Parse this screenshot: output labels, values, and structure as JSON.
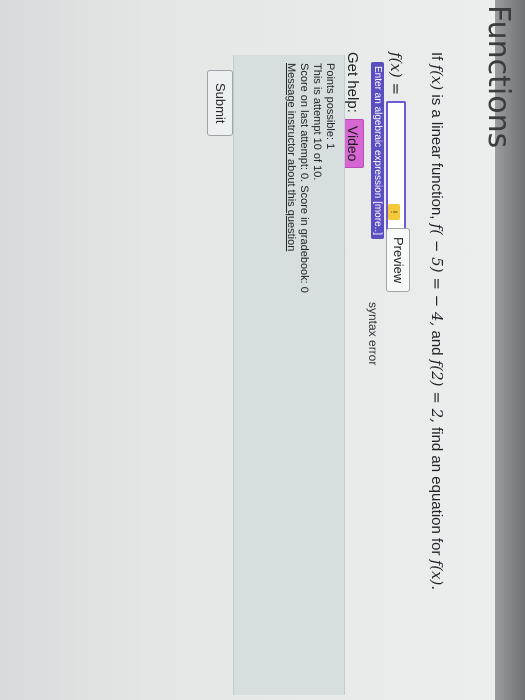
{
  "header": {
    "title": "Functions"
  },
  "question": {
    "prefix": "If",
    "func": "f(x)",
    "middle": "is a linear function,",
    "cond1": "f( − 5) = − 4,",
    "and": "and",
    "cond2": "f(2) = 2,",
    "ask": "find an equation for",
    "target": "f(x)."
  },
  "answer": {
    "label": "f(x) =",
    "value": "",
    "tooltip": "Enter an algebraic expression [more..]",
    "warning_icon": "warning-icon",
    "preview_label": "Preview",
    "status": "syntax error"
  },
  "help": {
    "label": "Get help:",
    "video_label": "Video"
  },
  "info": {
    "points": "Points possible: 1",
    "attempt": "This is attempt 10 of 10.",
    "score": "Score on last attempt: 0. Score in gradebook: 0",
    "message": "Message instructor about this question"
  },
  "actions": {
    "submit_label": "Submit"
  },
  "colors": {
    "accent": "#6e5ad6",
    "video": "#d667d2",
    "tooltip": "#5a4fc0"
  }
}
